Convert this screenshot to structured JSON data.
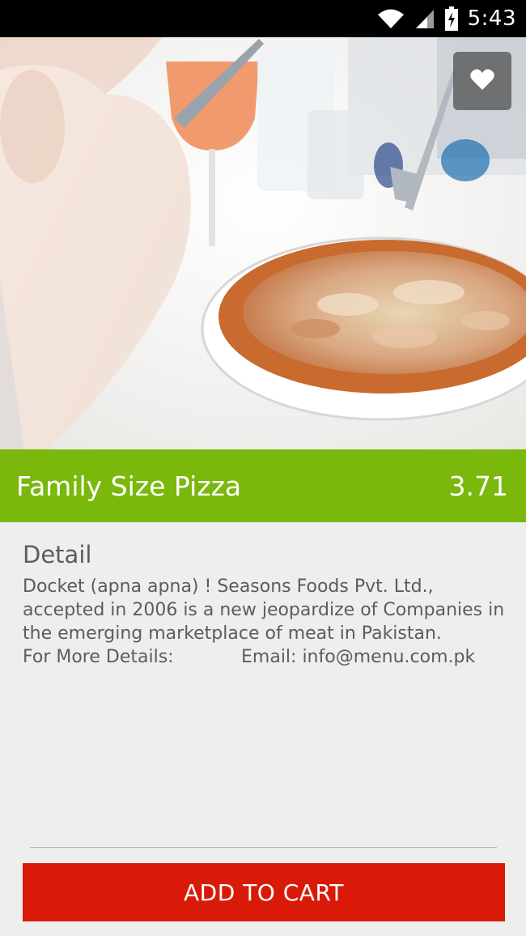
{
  "status_bar": {
    "time": "5:43",
    "icons": [
      "wifi-icon",
      "cell-signal-icon",
      "battery-charging-icon"
    ]
  },
  "hero": {
    "image": "pizza-photo",
    "favorite_icon": "heart-icon"
  },
  "product": {
    "name": "Family Size Pizza",
    "price": "3.71"
  },
  "detail": {
    "heading": "Detail",
    "description": "Docket (apna apna) ! Seasons Foods Pvt. Ltd., accepted in 2006 is a new jeopardize of Companies in the emerging marketplace of meat in Pakistan.",
    "more_label": "For More Details:",
    "email": "Email: info@menu.com.pk"
  },
  "actions": {
    "add_to_cart": "ADD TO CART"
  },
  "colors": {
    "title_bar": "#7ab80c",
    "cart_button": "#d91a08",
    "background": "#eeeeee",
    "status_bar": "#000000"
  }
}
